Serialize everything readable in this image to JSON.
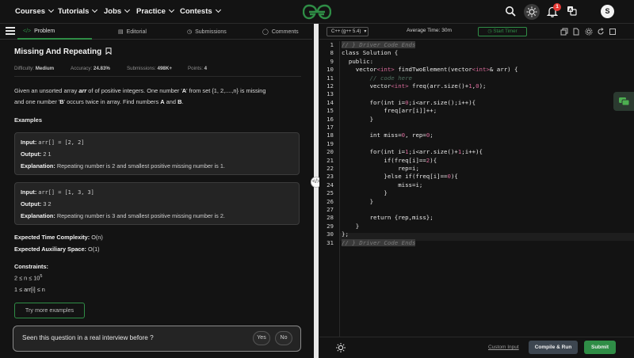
{
  "nav": {
    "items": [
      {
        "label": "Courses"
      },
      {
        "label": "Tutorials"
      },
      {
        "label": "Jobs"
      },
      {
        "label": "Practice"
      },
      {
        "label": "Contests"
      }
    ],
    "notification_count": "1",
    "avatar_initial": "S"
  },
  "tabs": [
    {
      "label": "Problem",
      "icon": "code-icon"
    },
    {
      "label": "Editorial",
      "icon": "document-icon"
    },
    {
      "label": "Submissions",
      "icon": "clock-icon"
    },
    {
      "label": "Comments",
      "icon": "chat-icon"
    }
  ],
  "problem": {
    "title": "Missing And Repeating",
    "difficulty_label": "Difficulty:",
    "difficulty": "Medium",
    "accuracy_label": "Accuracy:",
    "accuracy": "24.83%",
    "submissions_label": "Submissions:",
    "submissions": "498K+",
    "points_label": "Points:",
    "points": "4",
    "desc_line1_a": "Given an unsorted array ",
    "desc_line1_arr": "arr",
    "desc_line1_b": " of of positive integers. One number '",
    "desc_line1_A": "A",
    "desc_line1_c": "' from set {1, 2,....,n} is missing",
    "desc_line2_a": "and one number '",
    "desc_line2_B": "B",
    "desc_line2_b": "' occurs twice in array. Find numbers ",
    "desc_line2_A2": "A",
    "desc_line2_and": " and ",
    "desc_line2_B2": "B",
    "desc_line2_end": ".",
    "examples_heading": "Examples",
    "examples": [
      {
        "input_label": "Input:",
        "input": "arr[] = [2, 2]",
        "output_label": "Output:",
        "output": "2 1",
        "explanation_label": "Explanation:",
        "explanation": "Repeating number is 2 and smallest positive missing number is 1."
      },
      {
        "input_label": "Input:",
        "input": "arr[] = [1, 3, 3]",
        "output_label": "Output:",
        "output": "3 2",
        "explanation_label": "Explanation:",
        "explanation": "Repeating number is 3 and smallest positive missing number is 2."
      }
    ],
    "time_complexity_label": "Expected Time Complexity:",
    "time_complexity": "O(n)",
    "space_label": "Expected Auxiliary Space:",
    "space": "O(1)",
    "constraints_heading": "Constraints:",
    "constraint1": "2 ≤ n ≤ 10",
    "constraint1_sup": "5",
    "constraint2": "1 ≤ arr[i] ≤ n",
    "try_more": "Try more examples",
    "interview_question": "Seen this question in a real interview before ?",
    "yes": "Yes",
    "no": "No"
  },
  "editor": {
    "language": "C++ (g++ 5.4)",
    "avg_time": "Average Time: 30m",
    "start_timer": "Start Timer",
    "lines": [
      {
        "n": "1",
        "text": "// } Driver Code Ends"
      },
      {
        "n": "8",
        "text": "class Solution {"
      },
      {
        "n": "9",
        "text": "  public:"
      },
      {
        "n": "10",
        "text": "    vector<int> findTwoElement(vector<int>& arr) {"
      },
      {
        "n": "11",
        "text": "        // code here"
      },
      {
        "n": "12",
        "text": "        vector<int> freq(arr.size()+1,0);"
      },
      {
        "n": "13",
        "text": ""
      },
      {
        "n": "14",
        "text": "        for(int i=0;i<arr.size();i++){"
      },
      {
        "n": "15",
        "text": "            freq[arr[i]]++;"
      },
      {
        "n": "16",
        "text": "        }"
      },
      {
        "n": "17",
        "text": ""
      },
      {
        "n": "18",
        "text": "        int miss=0, rep=0;"
      },
      {
        "n": "19",
        "text": ""
      },
      {
        "n": "20",
        "text": "        for(int i=1;i<arr.size()+1;i++){"
      },
      {
        "n": "21",
        "text": "            if(freq[i]==2){"
      },
      {
        "n": "22",
        "text": "                rep=i;"
      },
      {
        "n": "23",
        "text": "            }else if(freq[i]==0){"
      },
      {
        "n": "24",
        "text": "                miss=i;"
      },
      {
        "n": "25",
        "text": "            }"
      },
      {
        "n": "26",
        "text": "        }"
      },
      {
        "n": "27",
        "text": ""
      },
      {
        "n": "28",
        "text": "        return {rep,miss};"
      },
      {
        "n": "29",
        "text": "    }"
      },
      {
        "n": "30",
        "text": "};"
      },
      {
        "n": "31",
        "text": "// } Driver Code Ends"
      }
    ],
    "custom_input": "Custom Input",
    "compile_run": "Compile & Run",
    "submit": "Submit"
  },
  "colors": {
    "accent": "#2f8d46",
    "background": "#131313",
    "panel": "#242424",
    "badge": "#e53935"
  }
}
